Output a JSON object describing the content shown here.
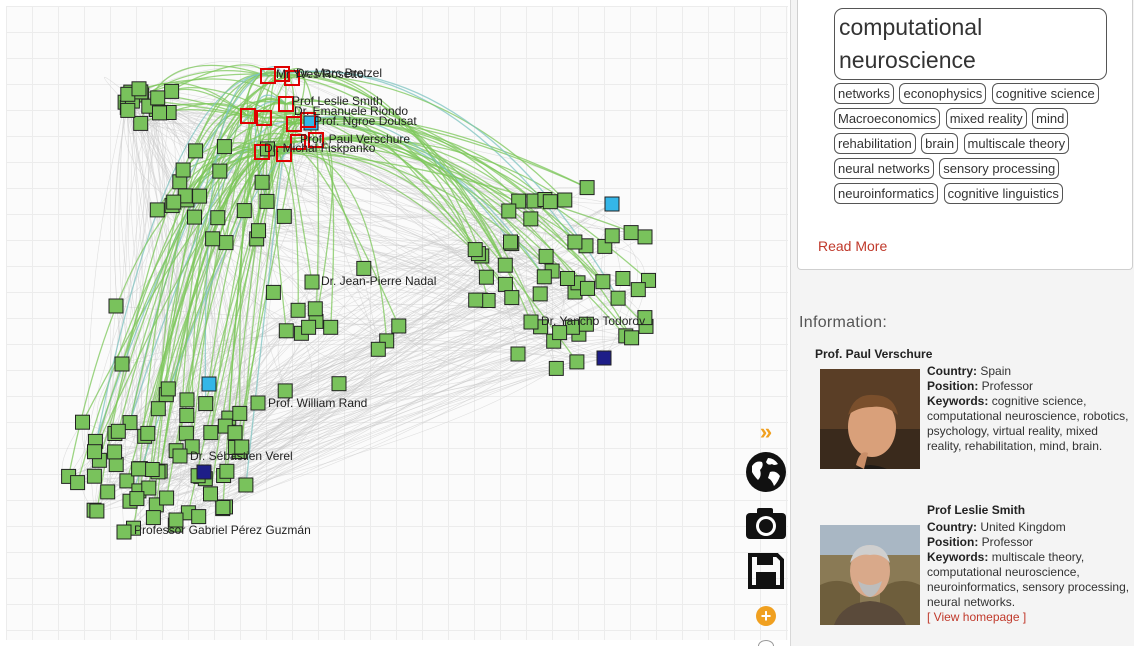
{
  "graph": {
    "labels": [
      {
        "text": "Mr Yves Rosetto"
      },
      {
        "text": "Dr. Marc Bretzel"
      },
      {
        "text": "Prof Leslie  Smith"
      },
      {
        "text": "Dr. Emanuele  Riondo"
      },
      {
        "text": "Prof. Ngroe Dousat"
      },
      {
        "text": "Prof. Paul Verschure"
      },
      {
        "text": "Dr. Michal Fiskpanko"
      },
      {
        "text": "Dr. Jean-Pierre  Nadal"
      },
      {
        "text": "Dr. Yancho  Todorov"
      },
      {
        "text": "Prof. William  Rand"
      },
      {
        "text": "Dr. Sébastien  Verel"
      },
      {
        "text": "Professor Gabriel  Pérez Guzmán"
      }
    ],
    "colors": {
      "node_fill": "#79c25c",
      "node_selected": "#e00000",
      "node_blue": "#34b6e8",
      "node_navy": "#1e1e88",
      "edge_green": "#7cc75a",
      "edge_gray": "#c9c9c9"
    }
  },
  "toolbar": {
    "expand": {
      "glyph": "»",
      "icon": "expand-icon"
    },
    "globe": {
      "icon": "globe-icon"
    },
    "camera": {
      "icon": "camera-icon"
    },
    "save": {
      "icon": "save-icon"
    },
    "add": {
      "glyph": "+",
      "icon": "add-icon"
    }
  },
  "keywords": {
    "tags": [
      "computational neuroscience",
      "networks",
      "econophysics",
      "cognitive science",
      "Macroeconomics",
      "mixed reality",
      "mind",
      "rehabilitation",
      "brain",
      "multiscale theory",
      "neural networks",
      "sensory processing",
      "neuroinformatics",
      "cognitive linguistics"
    ],
    "read_more": "Read More"
  },
  "information": {
    "title": "Information:",
    "labels": {
      "country": "Country:",
      "position": "Position:",
      "keywords": "Keywords:"
    },
    "people": [
      {
        "name": "Prof. Paul Verschure",
        "country": "Spain",
        "position": "Professor",
        "keywords": "cognitive science, computational neuroscience, robotics, psychology, virtual reality, mixed reality, rehabilitation, mind, brain."
      },
      {
        "name": "Prof Leslie Smith",
        "country": "United Kingdom",
        "position": "Professor",
        "keywords": "multiscale theory, computational neuroscience, neuroinformatics, sensory processing, neural networks.",
        "homepage_open": "[ ",
        "homepage": "View homepage",
        "homepage_close": " ]"
      }
    ]
  }
}
